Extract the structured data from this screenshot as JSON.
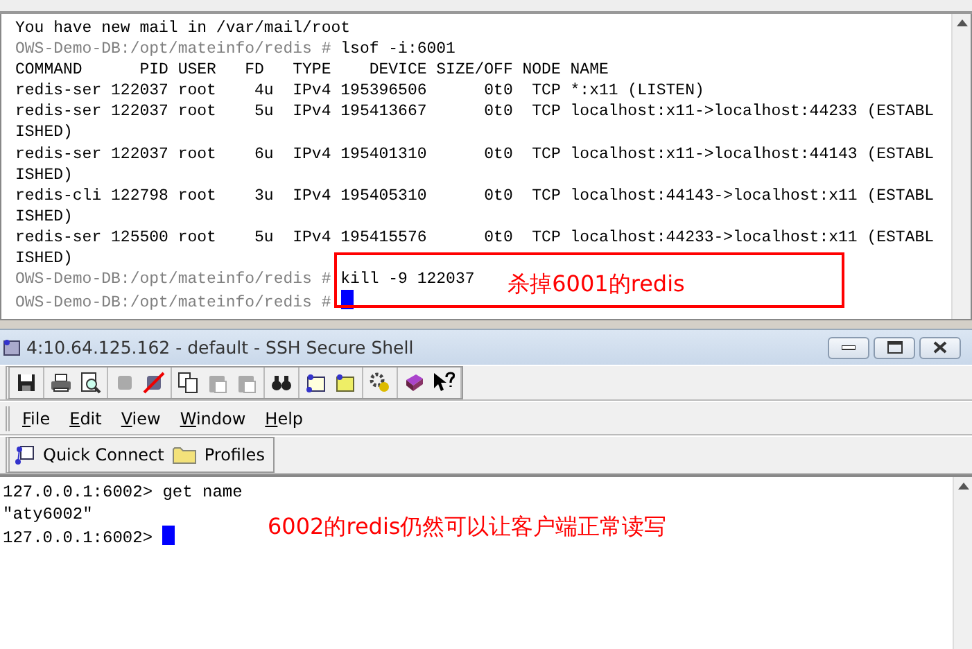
{
  "top_terminal": {
    "lines": [
      {
        "kind": "output",
        "text": "You have new mail in /var/mail/root",
        "cursor": false
      },
      {
        "kind": "shell-prompt",
        "prompt": "OWS-Demo-DB:/opt/mateinfo/redis #",
        "text": "lsof -i:6001",
        "cursor": false
      },
      {
        "kind": "output",
        "text": "COMMAND      PID USER   FD   TYPE    DEVICE SIZE/OFF NODE NAME",
        "cursor": false
      },
      {
        "kind": "output",
        "text": "redis-ser 122037 root    4u  IPv4 195396506      0t0  TCP *:x11 (LISTEN)",
        "cursor": false
      },
      {
        "kind": "output",
        "text": "redis-ser 122037 root    5u  IPv4 195413667      0t0  TCP localhost:x11->localhost:44233 (ESTABL",
        "cursor": false
      },
      {
        "kind": "output",
        "text": "ISHED)",
        "cursor": false
      },
      {
        "kind": "output",
        "text": "redis-ser 122037 root    6u  IPv4 195401310      0t0  TCP localhost:x11->localhost:44143 (ESTABL",
        "cursor": false
      },
      {
        "kind": "output",
        "text": "ISHED)",
        "cursor": false
      },
      {
        "kind": "output",
        "text": "redis-cli 122798 root    3u  IPv4 195405310      0t0  TCP localhost:44143->localhost:x11 (ESTABL",
        "cursor": false
      },
      {
        "kind": "output",
        "text": "ISHED)",
        "cursor": false
      },
      {
        "kind": "output",
        "text": "redis-ser 125500 root    5u  IPv4 195415576      0t0  TCP localhost:44233->localhost:x11 (ESTABL",
        "cursor": false
      },
      {
        "kind": "output",
        "text": "ISHED)",
        "cursor": false
      },
      {
        "kind": "shell-prompt",
        "prompt": "OWS-Demo-DB:/opt/mateinfo/redis #",
        "text": "kill -9 122037",
        "cursor": false
      },
      {
        "kind": "shell-prompt",
        "prompt": "OWS-Demo-DB:/opt/mateinfo/redis #",
        "cursor": true
      }
    ],
    "annotation": "杀掉6001的redis"
  },
  "ssh_window": {
    "title": "4:10.64.125.162 - default - SSH Secure Shell",
    "toolbar": [
      [
        {
          "kind": "save",
          "disabled": false
        }
      ],
      [
        {
          "kind": "print",
          "disabled": false
        },
        {
          "kind": "preview",
          "disabled": false
        }
      ],
      [
        {
          "kind": "connect",
          "disabled": true
        },
        {
          "kind": "disconnect",
          "disabled": false
        }
      ],
      [
        {
          "kind": "copy",
          "disabled": false
        },
        {
          "kind": "paste",
          "disabled": true
        },
        {
          "kind": "paste",
          "disabled": true
        }
      ],
      [
        {
          "kind": "find",
          "disabled": false
        }
      ],
      [
        {
          "kind": "settings-window",
          "disabled": false
        },
        {
          "kind": "transfer",
          "disabled": false
        }
      ],
      [
        {
          "kind": "gear",
          "disabled": false
        }
      ],
      [
        {
          "kind": "help",
          "disabled": false
        },
        {
          "kind": "whatsthis",
          "disabled": false
        }
      ]
    ],
    "menu": [
      "File",
      "Edit",
      "View",
      "Window",
      "Help"
    ],
    "quickbar": [
      {
        "kind": "quick-connect",
        "label": "Quick Connect"
      },
      {
        "kind": "profiles",
        "label": "Profiles"
      }
    ],
    "terminal": {
      "lines": [
        {
          "kind": "cli-prompt",
          "prompt": "127.0.0.1:6002>",
          "text": "get name",
          "cursor": false
        },
        {
          "kind": "output",
          "text": "\"aty6002\"",
          "cursor": false
        },
        {
          "kind": "cli-prompt",
          "prompt": "127.0.0.1:6002>",
          "cursor": true
        }
      ],
      "annotation": "6002的redis仍然可以让客户端正常读写"
    }
  }
}
